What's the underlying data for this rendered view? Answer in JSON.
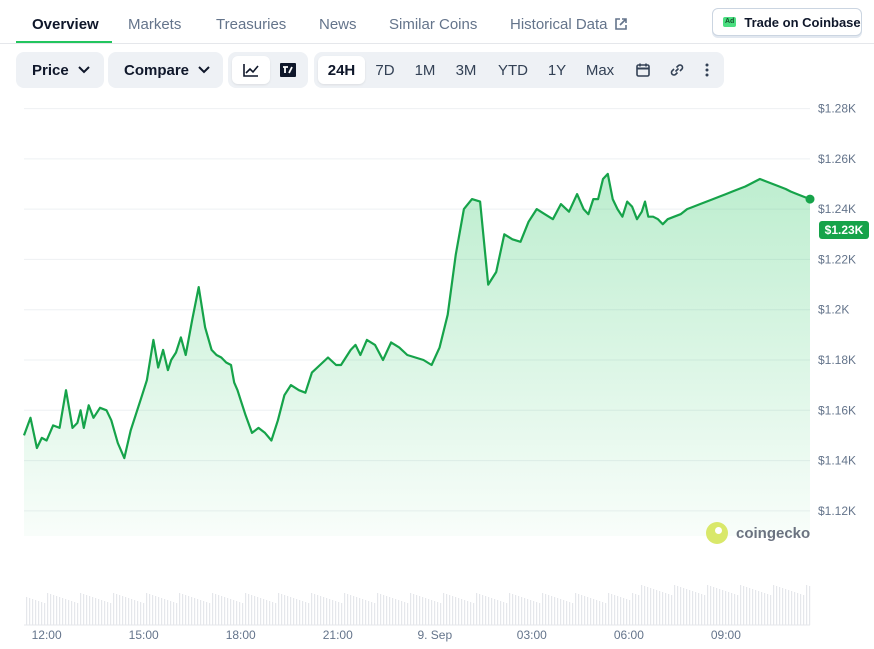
{
  "tabs": {
    "overview": "Overview",
    "markets": "Markets",
    "treasuries": "Treasuries",
    "news": "News",
    "similar": "Similar Coins",
    "historical": "Historical Data"
  },
  "ad": {
    "badge": "Ad",
    "label": "Trade on Coinbase"
  },
  "toolbar": {
    "price_label": "Price",
    "compare_label": "Compare",
    "ranges": [
      "24H",
      "7D",
      "1M",
      "3M",
      "YTD",
      "1Y",
      "Max"
    ],
    "active_range": "24H"
  },
  "icons": [
    "chevron-down-icon",
    "external-link-icon",
    "line-chart-icon",
    "tradingview-icon",
    "calendar-icon",
    "link-icon",
    "more-vertical-icon",
    "coingecko-logo"
  ],
  "colors": {
    "accent": "#16a34a",
    "line": "#16a34a",
    "fill": "#22c55e",
    "active_tab_underline": "#22c55e"
  },
  "chart_data": {
    "type": "area",
    "title": "",
    "xlabel": "",
    "ylabel": "",
    "y_axis_position": "right",
    "ylim": [
      1110,
      1285
    ],
    "yticks": [
      1120,
      1140,
      1160,
      1180,
      1200,
      1220,
      1240,
      1260,
      1280
    ],
    "ytick_labels": [
      "$1.12K",
      "$1.14K",
      "$1.16K",
      "$1.18K",
      "$1.2K",
      "$1.22K",
      "$1.24K",
      "$1.26K",
      "$1.28K"
    ],
    "xlim": [
      11.3,
      35.6
    ],
    "xticks": [
      12,
      15,
      18,
      21,
      24,
      27,
      30,
      33
    ],
    "xtick_labels": [
      "12:00",
      "15:00",
      "18:00",
      "21:00",
      "9. Sep",
      "03:00",
      "06:00",
      "09:00"
    ],
    "grid": true,
    "current_price_label": "$1.23K",
    "watermark": "coingecko",
    "series": [
      {
        "x": [
          11.3,
          11.5,
          11.7,
          11.85,
          12.0,
          12.2,
          12.4,
          12.6,
          12.8,
          12.95,
          13.05,
          13.15,
          13.3,
          13.45,
          13.65,
          13.85,
          14.0,
          14.2,
          14.4,
          14.6,
          14.8,
          14.95,
          15.1,
          15.3,
          15.45,
          15.6,
          15.75,
          15.85,
          16.0,
          16.15,
          16.3,
          16.5,
          16.7,
          16.9,
          17.1,
          17.25,
          17.4,
          17.55,
          17.7,
          17.8,
          17.9,
          18.0,
          18.15,
          18.35,
          18.55,
          18.75,
          18.95,
          19.15,
          19.35,
          19.55,
          19.8,
          20.0,
          20.2,
          20.45,
          20.7,
          20.95,
          21.1,
          21.25,
          21.4,
          21.55,
          21.7,
          21.9,
          22.15,
          22.4,
          22.65,
          22.9,
          23.15,
          23.4,
          23.65,
          23.9,
          24.15,
          24.4,
          24.65,
          24.9,
          25.15,
          25.4,
          25.65,
          25.9,
          26.15,
          26.4,
          26.65,
          26.9,
          27.15,
          27.4,
          27.65,
          27.9,
          28.15,
          28.4,
          28.6,
          28.75,
          28.9,
          29.05,
          29.2,
          29.35,
          29.5,
          29.65,
          29.8,
          29.95,
          30.1,
          30.25,
          30.4,
          30.5,
          30.6,
          30.75,
          30.9,
          31.05,
          31.2,
          31.4,
          31.6,
          31.8,
          32.0,
          32.2,
          32.4,
          32.6,
          32.8,
          33.0,
          33.2,
          33.4,
          33.6,
          33.75,
          33.9,
          34.05,
          34.25,
          34.45,
          34.65,
          34.85,
          35.0,
          35.2,
          35.4,
          35.6
        ],
        "values": [
          1150,
          1157,
          1145,
          1149,
          1148,
          1154,
          1153,
          1168,
          1153,
          1155,
          1160,
          1153,
          1162,
          1157,
          1161,
          1160,
          1156,
          1147,
          1141,
          1152,
          1160,
          1166,
          1172,
          1188,
          1177,
          1184,
          1176,
          1180,
          1183,
          1189,
          1182,
          1196,
          1209,
          1193,
          1184,
          1182,
          1181,
          1179,
          1178,
          1171,
          1168,
          1164,
          1158,
          1151,
          1153,
          1151,
          1148,
          1156,
          1166,
          1170,
          1168,
          1167,
          1175,
          1178,
          1181,
          1178,
          1178,
          1181,
          1184,
          1186,
          1182,
          1188,
          1186,
          1180,
          1187,
          1185,
          1182,
          1181,
          1180,
          1178,
          1185,
          1198,
          1222,
          1240,
          1244,
          1243,
          1210,
          1215,
          1230,
          1228,
          1227,
          1235,
          1240,
          1238,
          1236,
          1242,
          1239,
          1246,
          1240,
          1238,
          1244,
          1244,
          1252,
          1254,
          1244,
          1240,
          1237,
          1243,
          1241,
          1236,
          1239,
          1243,
          1237,
          1237,
          1236,
          1234,
          1236,
          1237,
          1238,
          1240,
          1241,
          1242,
          1243,
          1244,
          1245,
          1246,
          1247,
          1248,
          1249,
          1250,
          1251,
          1252,
          1251,
          1250,
          1249,
          1248,
          1247,
          1246,
          1245,
          1244
        ]
      }
    ]
  }
}
